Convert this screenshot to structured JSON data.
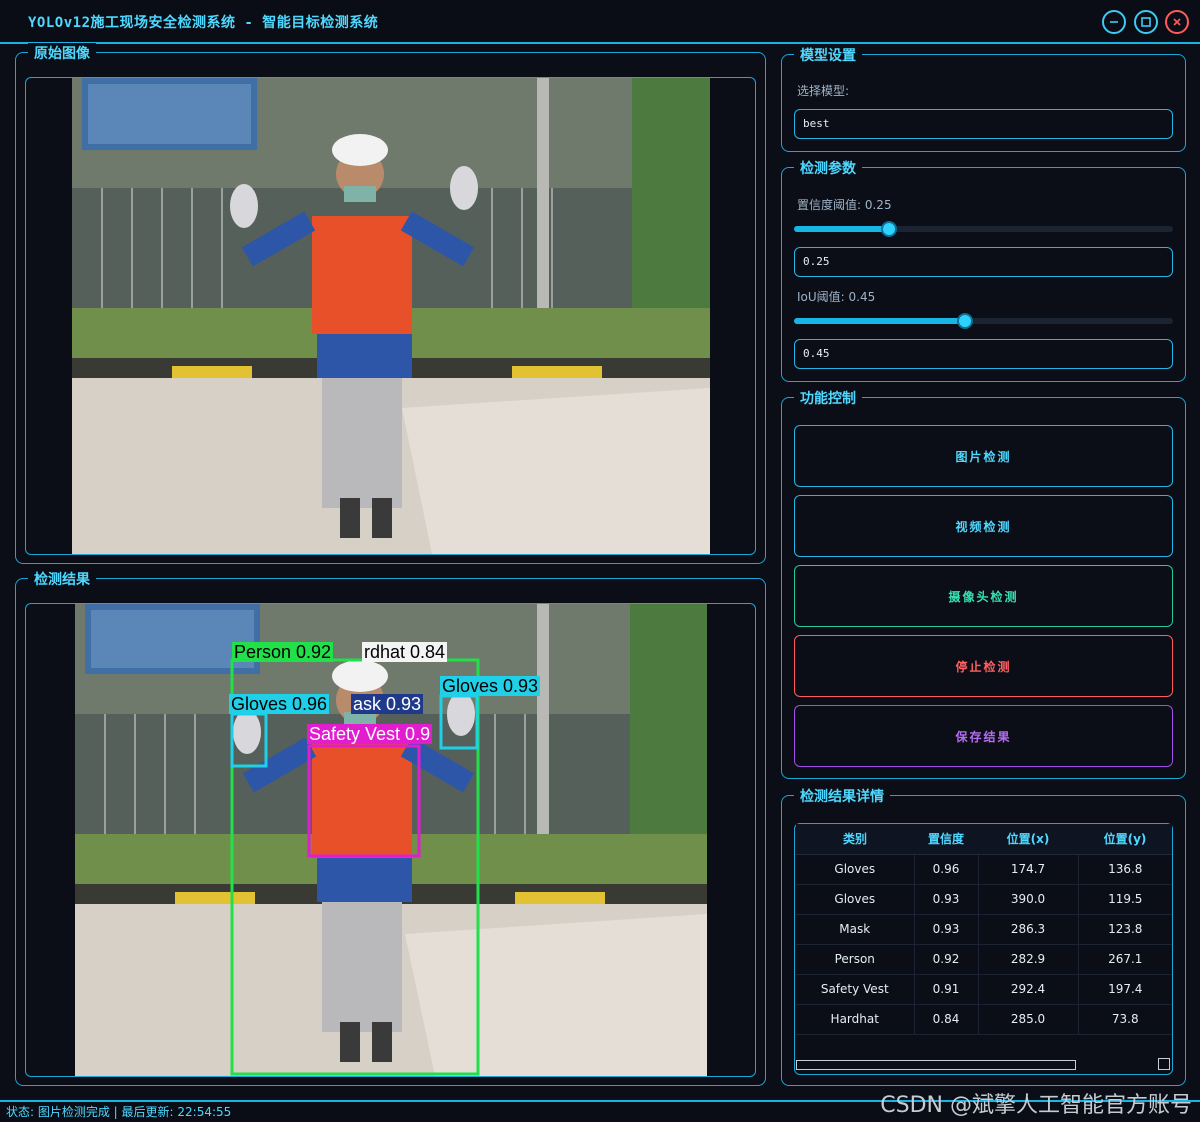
{
  "window": {
    "title": "YOLOv12施工现场安全检测系统 - 智能目标检测系统",
    "minimize_icon": "minimize-icon",
    "maximize_icon": "maximize-icon",
    "close_icon": "close-icon"
  },
  "original_panel": {
    "title": "原始图像"
  },
  "result_panel": {
    "title": "检测结果",
    "detections": [
      {
        "label": "Person 0.92",
        "color": "#22e04a",
        "text_color": "#000000"
      },
      {
        "label": "rdhat 0.84",
        "color": "#f4f4f4",
        "text_color": "#000000"
      },
      {
        "label": "Gloves 0.96",
        "color": "#1fd0e8",
        "text_color": "#000000"
      },
      {
        "label": "ask 0.93",
        "color": "#1f3a8a",
        "text_color": "#ffffff"
      },
      {
        "label": "Gloves 0.93",
        "color": "#1fd0e8",
        "text_color": "#000000"
      },
      {
        "label": "Safety Vest 0.9",
        "color": "#e21ccf",
        "text_color": "#ffffff"
      }
    ]
  },
  "model_settings": {
    "title": "模型设置",
    "select_label": "选择模型:",
    "model_value": "best"
  },
  "detect_params": {
    "title": "检测参数",
    "conf_label": "置信度阈值: 0.25",
    "conf_value": "0.25",
    "conf_level": 0.25,
    "iou_label": "IoU阈值: 0.45",
    "iou_value": "0.45",
    "iou_level": 0.45
  },
  "controls": {
    "title": "功能控制",
    "image_detect": "图片检测",
    "video_detect": "视频检测",
    "camera_detect": "摄像头检测",
    "stop_detect": "停止检测",
    "save_result": "保存结果",
    "colors": {
      "image": "#22b6e8",
      "video": "#22b6e8",
      "camera": "#22c9a0",
      "stop": "#ff5b5b",
      "save": "#a24fe8"
    }
  },
  "details": {
    "title": "检测结果详情",
    "headers": [
      "类别",
      "置信度",
      "位置(x)",
      "位置(y)"
    ],
    "rows": [
      [
        "Gloves",
        "0.96",
        "174.7",
        "136.8"
      ],
      [
        "Gloves",
        "0.93",
        "390.0",
        "119.5"
      ],
      [
        "Mask",
        "0.93",
        "286.3",
        "123.8"
      ],
      [
        "Person",
        "0.92",
        "282.9",
        "267.1"
      ],
      [
        "Safety Vest",
        "0.91",
        "292.4",
        "197.4"
      ],
      [
        "Hardhat",
        "0.84",
        "285.0",
        "73.8"
      ]
    ]
  },
  "status": {
    "text": "状态: 图片检测完成 | 最后更新: 22:54:55"
  },
  "watermark": "CSDN @斌擎人工智能官方账号"
}
